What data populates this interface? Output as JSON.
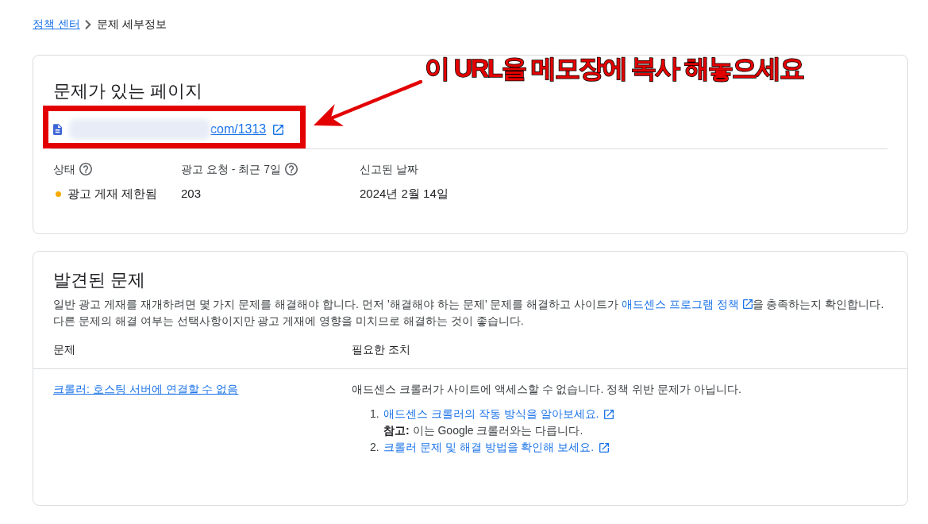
{
  "breadcrumb": {
    "link": "정책 센터",
    "current": "문제 세부정보"
  },
  "page_card": {
    "title": "문제가 있는 페이지",
    "redacted": true,
    "url_visible": "com/1313",
    "stats": [
      {
        "label": "상태",
        "help": true,
        "value": "광고 게재 제한됨",
        "color": "#f9ab00"
      },
      {
        "label": "광고 요청 - 최근 7일",
        "help": true,
        "value": "203"
      },
      {
        "label": "신고된 날짜",
        "help": false,
        "value": "2024년 2월 14일"
      }
    ]
  },
  "annotation": {
    "text": "이 URL을 메모장에 복사 해놓으세요"
  },
  "issues_card": {
    "title": "발견된 문제",
    "description": {
      "before": "일반 광고 게재를 재개하려면 몇 가지 문제를 해결해야 합니다. 먼저 ’해결해야 하는 문제’ 문제를 해결하고 사이트가 ",
      "link": "애드센스 프로그램 정책",
      "after": "을 충족하는지 확인합니다. 다른 문제의 해결 여부는 선택사항이지만 광고 게재에 영향을 미치므로 해결하는 것이 좋습니다."
    },
    "columns": [
      "문제",
      "필요한 조치"
    ],
    "rows": [
      {
        "issue": "크롤러: 호스팅 서버에 연결할 수 없음",
        "action": "애드센스 크롤러가 사이트에 액세스할 수 없습니다. 정책 위반 문제가 아닙니다.",
        "steps": [
          {
            "number": "1.",
            "link": "애드센스 크롤러의 작동 방식을 알아보세요.",
            "note": "**참고:** 이는 Google 크롤러와는 다릅니다."
          },
          {
            "number": "2.",
            "link": "크롤러 문제 및 해결 방법을 확인해 보세요."
          }
        ]
      }
    ]
  }
}
